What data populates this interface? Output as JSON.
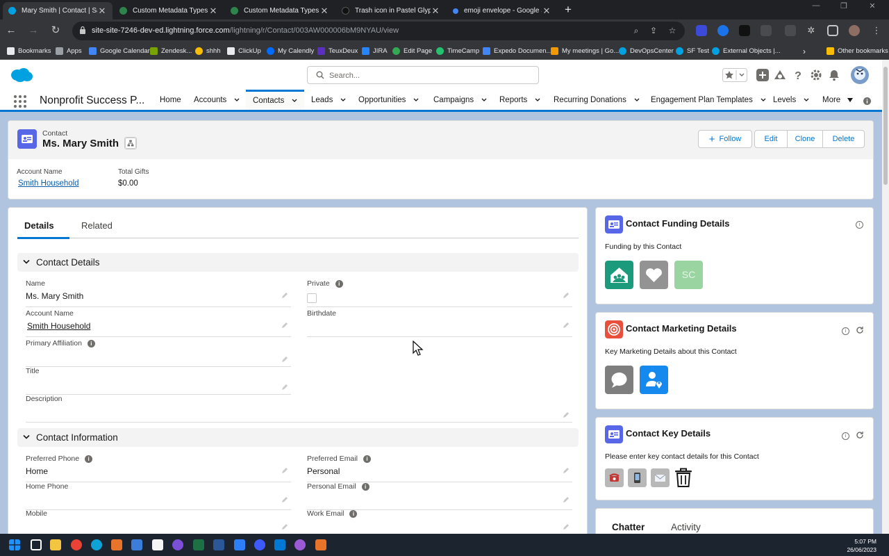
{
  "browser": {
    "tabs": [
      {
        "title": "Mary Smith | Contact | Salesforce",
        "active": true,
        "color": "#00a1e0"
      },
      {
        "title": "Custom Metadata Types | Salesforce",
        "active": false,
        "color": "#2e844a"
      },
      {
        "title": "Custom Metadata Types | Salesforce",
        "active": false,
        "color": "#2e844a"
      },
      {
        "title": "Trash icon in Pastel Glyph Style",
        "active": false,
        "color": "#202124"
      },
      {
        "title": "emoji envelope - Google Search",
        "active": false,
        "color": "#4285f4"
      }
    ],
    "url_host": "site-site-7246-dev-ed.lightning.force.com",
    "url_path": "/lightning/r/Contact/003AW000006bM9NYAU/view",
    "bookmarks": [
      "Bookmarks",
      "Apps",
      "Google Calendar",
      "Zendesk...",
      "shhh",
      "ClickUp",
      "My Calendly",
      "TeuxDeux",
      "JIRA",
      "Edit Page",
      "TimeCamp",
      "Expedo Documen...",
      "My meetings | Go...",
      "DevOpsCenter",
      "SF Test",
      "External Objects |...",
      "Other bookmarks"
    ]
  },
  "sf": {
    "search_placeholder": "Search...",
    "app_name": "Nonprofit Success P...",
    "nav": [
      {
        "label": "Home",
        "menu": false
      },
      {
        "label": "Accounts",
        "menu": true
      },
      {
        "label": "Contacts",
        "menu": true,
        "active": true
      },
      {
        "label": "Leads",
        "menu": true
      },
      {
        "label": "Opportunities",
        "menu": true
      },
      {
        "label": "Campaigns",
        "menu": true
      },
      {
        "label": "Reports",
        "menu": true
      },
      {
        "label": "Recurring Donations",
        "menu": true
      },
      {
        "label": "Engagement Plan Templates",
        "menu": true
      },
      {
        "label": "Levels",
        "menu": true
      },
      {
        "label": "More",
        "menu": true
      }
    ]
  },
  "highlights": {
    "object_label": "Contact",
    "record_name": "Ms. Mary Smith",
    "buttons": {
      "follow": "Follow",
      "edit": "Edit",
      "clone": "Clone",
      "delete": "Delete"
    },
    "account_label": "Account Name",
    "account_value": "Smith Household",
    "gifts_label": "Total Gifts",
    "gifts_value": "$0.00"
  },
  "detail": {
    "tab_details": "Details",
    "tab_related": "Related",
    "section_contact_details": "Contact Details",
    "section_contact_information": "Contact Information",
    "fields": {
      "name_label": "Name",
      "name_value": "Ms. Mary Smith",
      "private_label": "Private",
      "account_label": "Account Name",
      "account_value": "Smith Household",
      "birthdate_label": "Birthdate",
      "affiliation_label": "Primary Affiliation",
      "title_label": "Title",
      "description_label": "Description",
      "pref_phone_label": "Preferred Phone",
      "pref_phone_value": "Home",
      "pref_email_label": "Preferred Email",
      "pref_email_value": "Personal",
      "home_phone_label": "Home Phone",
      "personal_email_label": "Personal Email",
      "mobile_label": "Mobile",
      "work_email_label": "Work Email"
    }
  },
  "right": {
    "funding_title": "Contact Funding Details",
    "funding_sub": "Funding by this Contact",
    "funding_tile_text": "SC",
    "marketing_title": "Contact Marketing Details",
    "marketing_sub": "Key Marketing Details about this Contact",
    "key_title": "Contact Key Details",
    "key_sub": "Please enter key contact details for this Contact",
    "chatter_tab": "Chatter",
    "activity_tab": "Activity"
  },
  "clock": {
    "time": "5:07 PM",
    "date": "26/06/2023"
  },
  "colors": {
    "brand": "#0176d3",
    "contact_icon": "#5867e8",
    "funding_green": "#1b9a7c",
    "marketing_red": "#e9503c",
    "marketing_blue": "#1589ee"
  }
}
